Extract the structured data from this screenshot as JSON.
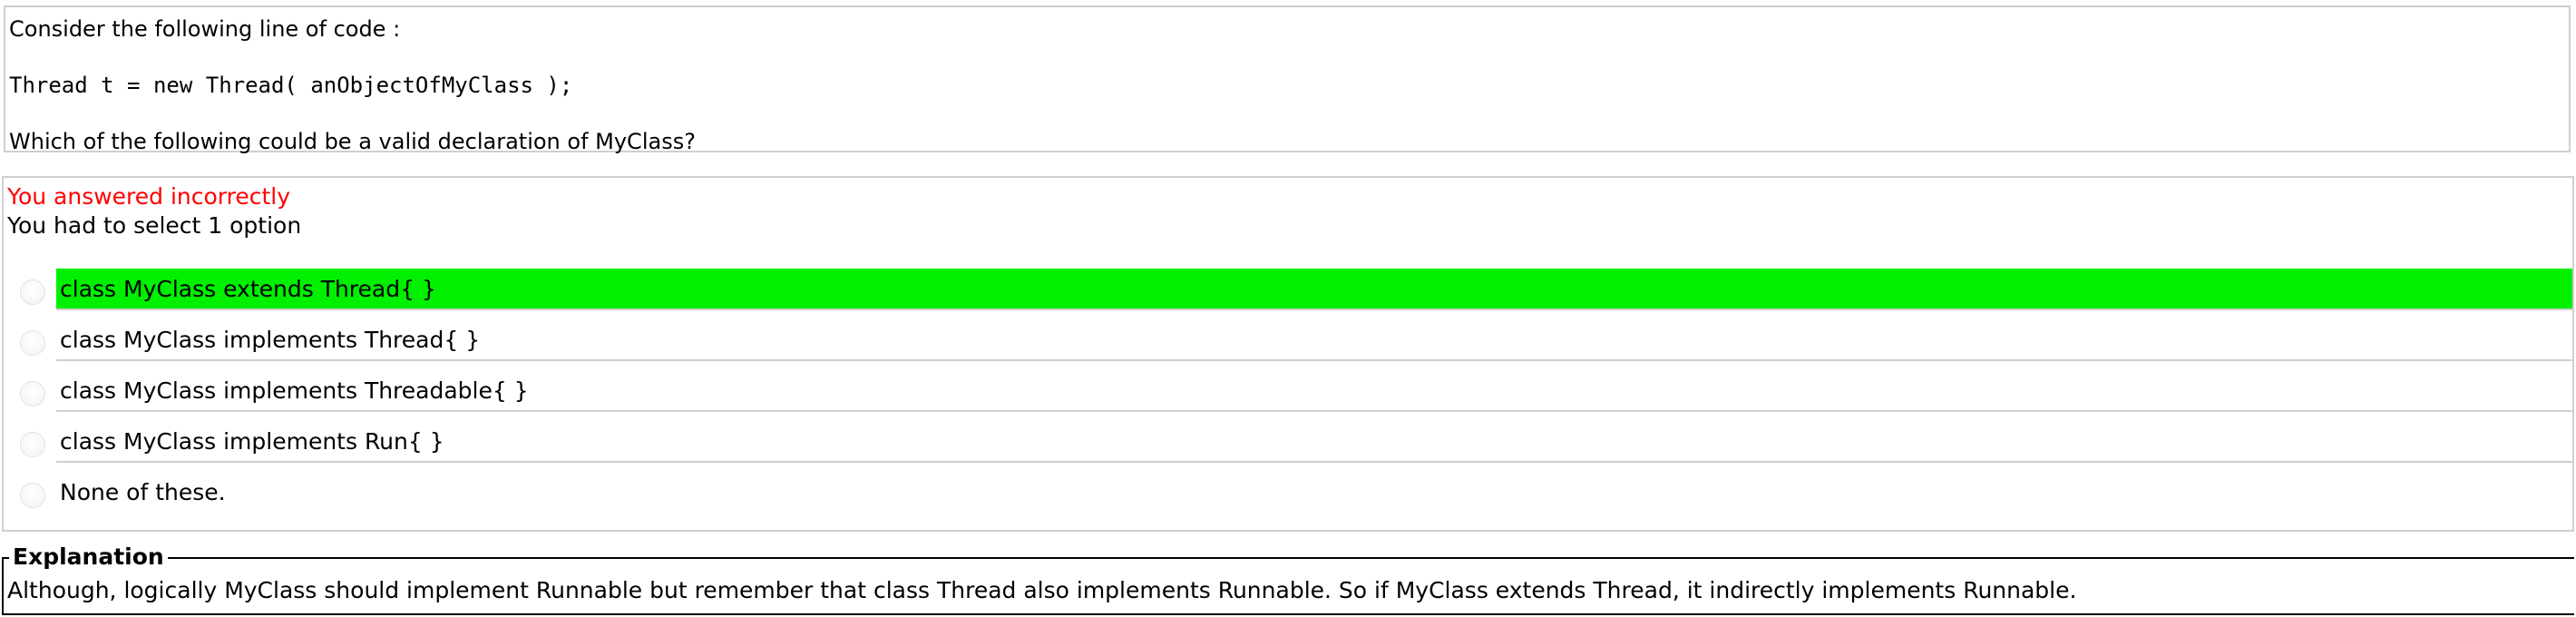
{
  "question": {
    "intro": "Consider the following line of code :",
    "code": "Thread t = new Thread( anObjectOfMyClass );",
    "prompt": "Which of the following could be a valid declaration of MyClass?"
  },
  "result": {
    "status": "You answered incorrectly",
    "status_color": "#ff0000",
    "instruction": "You had to select 1 option"
  },
  "options": [
    {
      "label": "class MyClass extends Thread{ }",
      "correct": true
    },
    {
      "label": "class MyClass implements Thread{ }",
      "correct": false
    },
    {
      "label": "class MyClass implements Threadable{ }",
      "correct": false
    },
    {
      "label": "class MyClass implements Run{ }",
      "correct": false
    },
    {
      "label": "None of these.",
      "correct": false
    }
  ],
  "highlight_color": "#00f000",
  "explanation": {
    "legend": "Explanation",
    "text": "Although, logically MyClass should implement Runnable but remember that class Thread also implements Runnable. So if MyClass extends Thread, it indirectly implements Runnable."
  }
}
